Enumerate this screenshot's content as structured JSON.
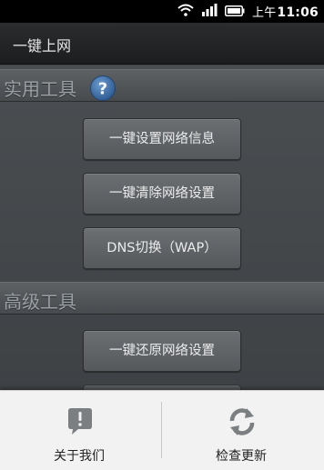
{
  "status_bar": {
    "time_prefix": "上午",
    "time": "11:06",
    "icons": [
      "wifi-icon",
      "signal-icon",
      "battery-icon"
    ]
  },
  "app": {
    "title": "一键上网"
  },
  "sections": [
    {
      "title": "实用工具",
      "help_icon": "question-icon",
      "buttons": [
        "一键设置网络信息",
        "一键清除网络设置",
        "DNS切换（WAP）"
      ]
    },
    {
      "title": "高级工具",
      "buttons": [
        "一键还原网络设置"
      ]
    }
  ],
  "menu": {
    "items": [
      {
        "label": "关于我们",
        "icon": "info-icon"
      },
      {
        "label": "检查更新",
        "icon": "refresh-icon"
      }
    ]
  },
  "colors": {
    "accent_blue": "#3d6fa8",
    "menu_icon_gray": "#7c7f82"
  }
}
